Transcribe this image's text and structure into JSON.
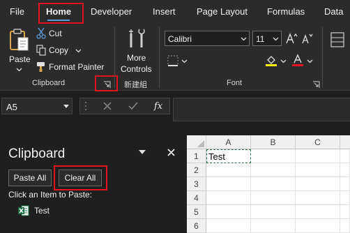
{
  "tabs": [
    "File",
    "Home",
    "Developer",
    "Insert",
    "Page Layout",
    "Formulas",
    "Data"
  ],
  "ribbon": {
    "clipboard": {
      "paste": "Paste",
      "cut": "Cut",
      "copy": "Copy",
      "format_painter": "Format Painter",
      "group_label": "Clipboard"
    },
    "more_controls": {
      "line1": "More",
      "line2": "Controls",
      "group_label": "新建組"
    },
    "font": {
      "name": "Calibri",
      "size": "11",
      "group_label": "Font",
      "highlight_color": "#ffff00",
      "font_color": "#e81123"
    }
  },
  "formula_bar": {
    "name_box": "A5",
    "fx": "fx"
  },
  "clipboard_pane": {
    "title": "Clipboard",
    "paste_all": "Paste All",
    "clear_all": "Clear All",
    "instruction": "Click an Item to Paste:",
    "items": [
      "Test"
    ]
  },
  "sheet": {
    "columns": [
      "A",
      "B",
      "C"
    ],
    "rows": [
      "1",
      "2",
      "3",
      "4",
      "5",
      "6"
    ],
    "a1": "Test"
  },
  "colors": {
    "highlight_box": "#e81123",
    "accent": "#5b9bd5"
  }
}
